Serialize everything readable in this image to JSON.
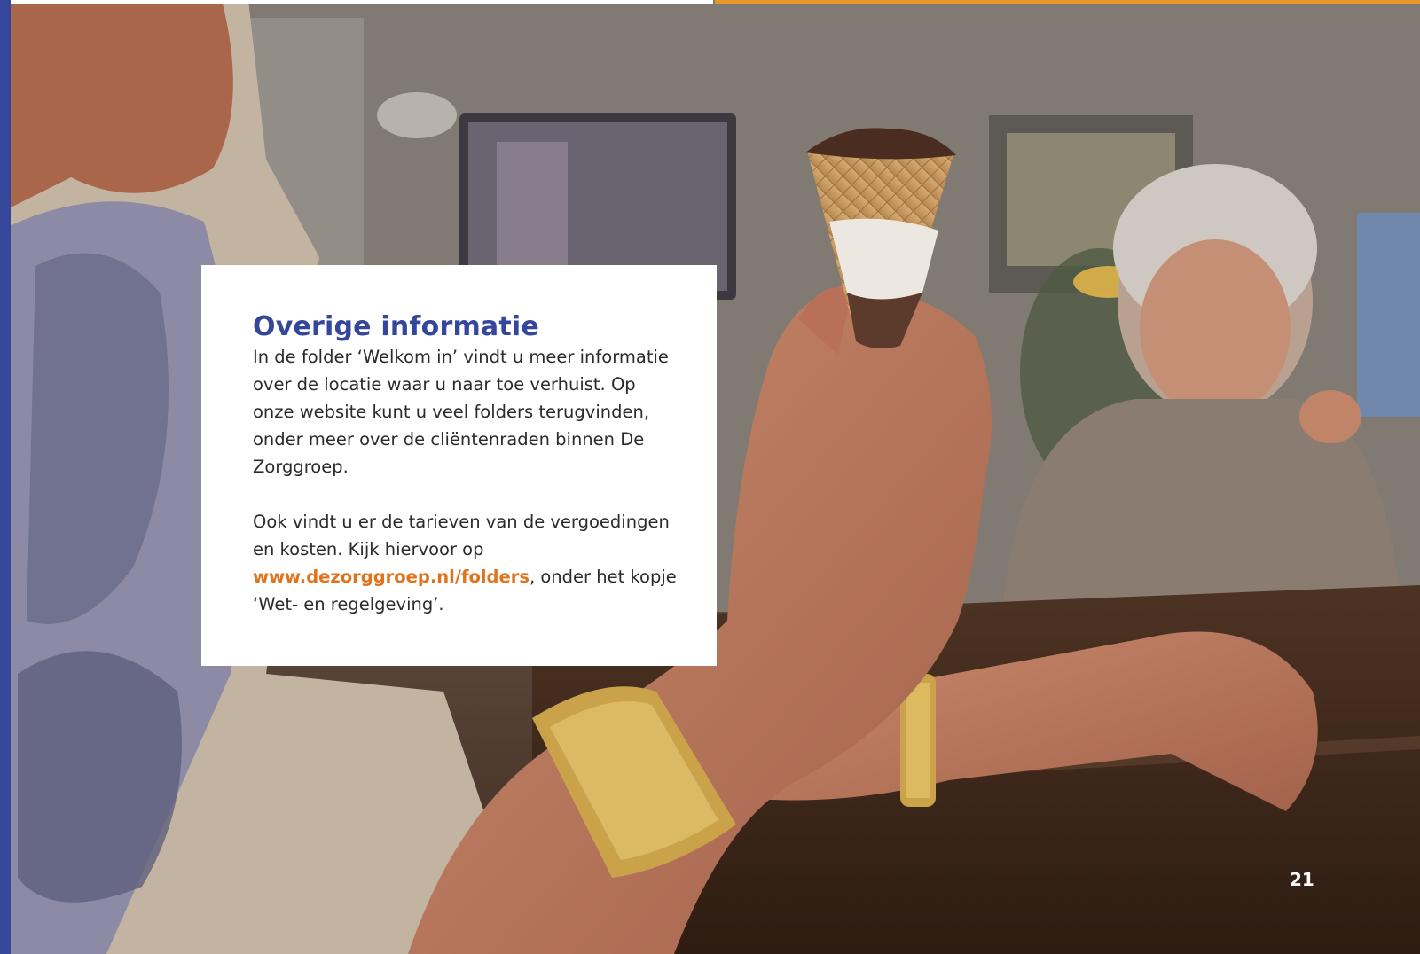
{
  "colors": {
    "brand_blue": "#35479a",
    "accent_orange": "#e8962a",
    "link_orange": "#e0731c",
    "text": "#2b2b2b"
  },
  "photo": {
    "subject": "elderly-hands-holding-ice-cream-cone"
  },
  "card": {
    "title": "Overige informatie",
    "paragraph1": "In de folder ‘Welkom in’ vindt u meer informatie over de locatie waar u naar toe verhuist. Op onze website kunt u veel folders terugvinden, onder meer over de cliëntenraden binnen De Zorggroep.",
    "paragraph2_before": "Ook vindt u er de tarieven van de vergoedingen en kosten. Kijk hiervoor op ",
    "link_text": "www.dezorggroep.nl/folders",
    "paragraph2_after": ", onder het kopje ‘Wet- en regelgeving’."
  },
  "page_number": "21"
}
